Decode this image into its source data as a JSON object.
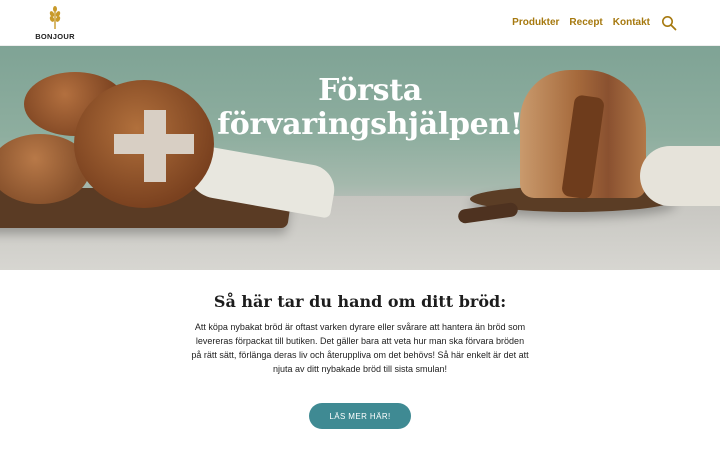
{
  "header": {
    "logo_text": "BONJOUR",
    "nav": [
      "Produkter",
      "Recept",
      "Kontakt"
    ],
    "search_icon": "search-icon"
  },
  "hero": {
    "title_line1": "Första",
    "title_line2": "förvaringshjälpen!"
  },
  "content": {
    "title": "Så här tar du hand om ditt bröd:",
    "body": "Att köpa nybakat bröd är oftast varken dyrare eller svårare att hantera än bröd som levereras förpackat till butiken. Det gäller bara att veta hur man ska förvara bröden på rätt sätt, förlänga deras liv och återuppliva om det behövs! Så här enkelt är det att njuta av ditt nybakade bröd till sista smulan!",
    "cta_label": "LÄS MER HÄR!"
  },
  "colors": {
    "accent": "#a6790f",
    "button": "#3f8a93"
  }
}
